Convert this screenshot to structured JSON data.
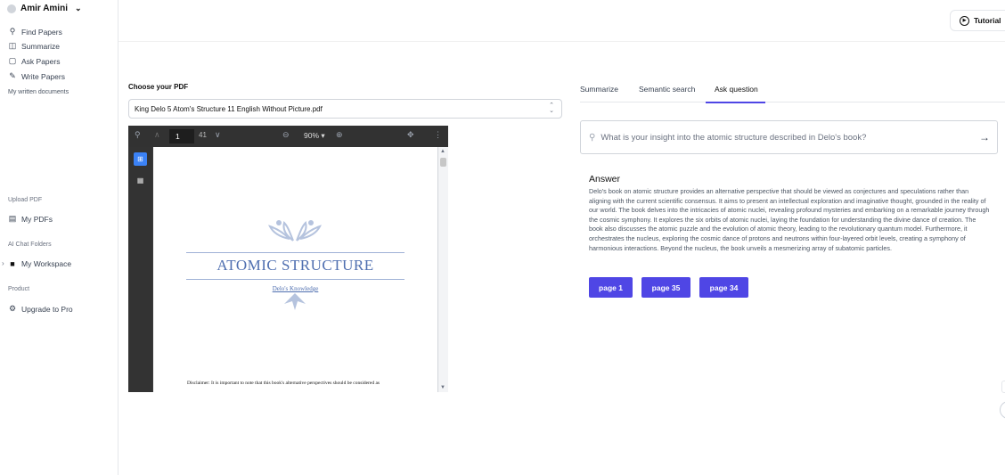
{
  "user": {
    "name": "Amir Amini"
  },
  "sidebar": {
    "nav": [
      {
        "label": "Find Papers",
        "icon": "search-icon"
      },
      {
        "label": "Summarize",
        "icon": "book-icon"
      },
      {
        "label": "Ask Papers",
        "icon": "chat-icon"
      },
      {
        "label": "Write Papers",
        "icon": "pen-icon"
      }
    ],
    "my_written": "My written documents",
    "upload_label": "Upload PDF",
    "my_pdfs": "My PDFs",
    "ai_chat_label": "AI Chat Folders",
    "workspace": "My Workspace",
    "product_label": "Product",
    "upgrade": "Upgrade to Pro"
  },
  "header": {
    "tutorial": "Tutorial"
  },
  "pdf": {
    "choose_label": "Choose your PDF",
    "selected_file": "King Delo 5 Atom's Structure 11 English Without Picture.pdf",
    "viewer": {
      "current_page": "1",
      "total_pages": "41",
      "zoom": "90%"
    },
    "document": {
      "title": "ATOMIC STRUCTURE",
      "subtitle": "Delo's Knowledge",
      "disclaimer": "Disclaimer: It is important to note that this book's alternative perspectives should be considered as"
    }
  },
  "tabs": [
    {
      "label": "Summarize",
      "active": false
    },
    {
      "label": "Semantic search",
      "active": false
    },
    {
      "label": "Ask question",
      "active": true
    }
  ],
  "question": "What is your insight into the atomic structure described in Delo's book?",
  "answer": {
    "title": "Answer",
    "text": "Delo's book on atomic structure provides an alternative perspective that should be viewed as conjectures and speculations rather than aligning with the current scientific consensus. It aims to present an intellectual exploration and imaginative thought, grounded in the reality of our world. The book delves into the intricacies of atomic nuclei, revealing profound mysteries and embarking on a remarkable journey through the cosmic symphony. It explores the six orbits of atomic nuclei, laying the foundation for understanding the divine dance of creation. The book also discusses the atomic puzzle and the evolution of atomic theory, leading to the revolutionary quantum model. Furthermore, it orchestrates the nucleus, exploring the cosmic dance of protons and neutrons within four-layered orbit levels, creating a symphony of harmonious interactions. Beyond the nucleus, the book unveils a mesmerizing array of subatomic particles.",
    "pages": [
      "page 1",
      "page 35",
      "page 34"
    ]
  },
  "colors": {
    "accent": "#4f46e5",
    "doc_blue": "#4f6fb0"
  }
}
